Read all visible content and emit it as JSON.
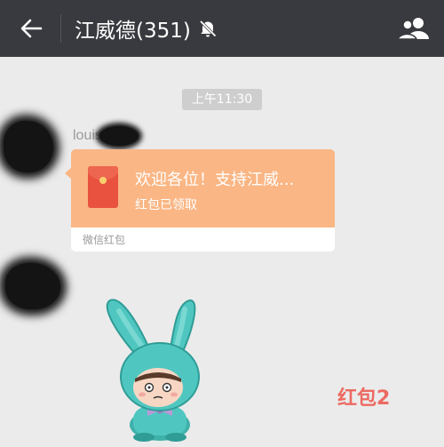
{
  "header": {
    "back_icon": "arrow-left-icon",
    "title": "江威德(351)",
    "mute_icon": "bell-off-icon",
    "group_icon": "group-people-icon"
  },
  "timestamp": "上午11:30",
  "messages": [
    {
      "type": "red_packet",
      "sender_name": "louis",
      "title": "欢迎各位！支持江威...",
      "status": "红包已领取",
      "footer": "微信红包",
      "icon": "red-envelope-icon"
    },
    {
      "type": "sticker",
      "icon": "bunny-hat-character-sticker"
    }
  ],
  "caption": "红包2",
  "colors": {
    "header_bg": "#393a3f",
    "chat_bg": "#ebebeb",
    "red_packet_bg": "#fab684",
    "caption": "#ec6a62"
  }
}
